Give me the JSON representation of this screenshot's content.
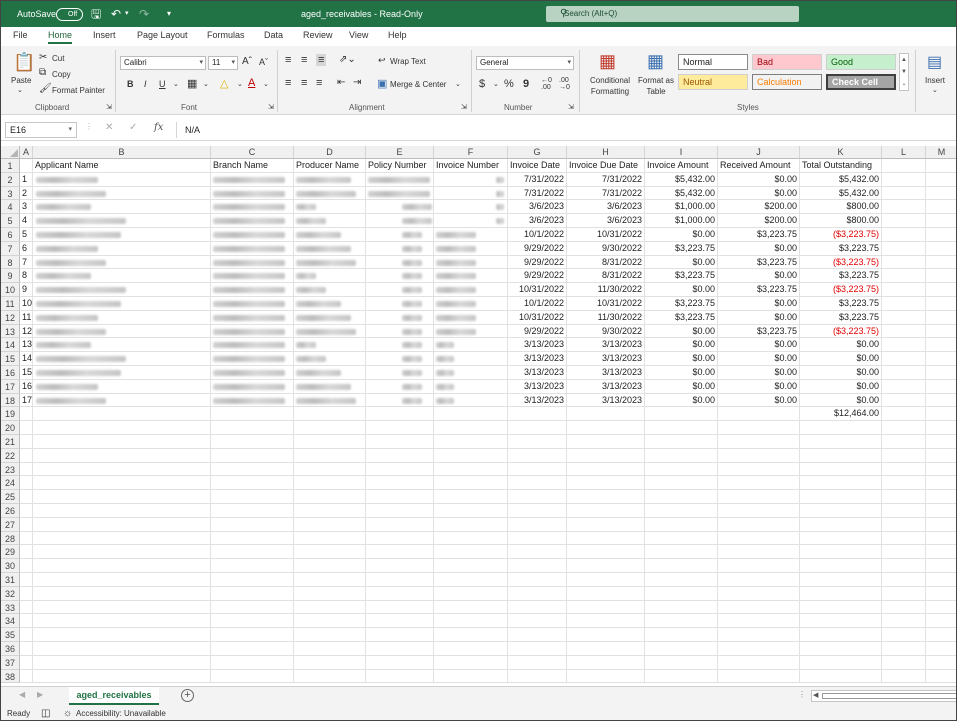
{
  "titlebar": {
    "autosave_label": "AutoSave",
    "autosave_state": "Off",
    "doc_title": "aged_receivables - Read-Only",
    "search_placeholder": "Search (Alt+Q)"
  },
  "menu": {
    "tabs": [
      "File",
      "Home",
      "Insert",
      "Page Layout",
      "Formulas",
      "Data",
      "Review",
      "View",
      "Help"
    ],
    "active": "Home"
  },
  "ribbon": {
    "clipboard": {
      "paste": "Paste",
      "cut": "Cut",
      "copy": "Copy",
      "format_painter": "Format Painter",
      "label": "Clipboard"
    },
    "font": {
      "name": "Calibri",
      "size": "11",
      "label": "Font"
    },
    "alignment": {
      "wrap_text": "Wrap Text",
      "merge_center": "Merge & Center",
      "label": "Alignment"
    },
    "number": {
      "format": "General",
      "label": "Number"
    },
    "styles": {
      "conditional_formatting": "Conditional Formatting",
      "format_as_table": "Format as Table",
      "normal": "Normal",
      "bad": "Bad",
      "good": "Good",
      "neutral": "Neutral",
      "calculation": "Calculation",
      "check_cell": "Check Cell",
      "label": "Styles"
    },
    "cells": {
      "insert": "Insert"
    }
  },
  "formula_bar": {
    "name_box": "E16",
    "fx": "fx",
    "value": "N/A"
  },
  "columns": [
    "A",
    "B",
    "C",
    "D",
    "E",
    "F",
    "G",
    "H",
    "I",
    "J",
    "K",
    "L",
    "M"
  ],
  "headers": {
    "b": "Applicant Name",
    "c": "Branch Name",
    "d": "Producer Name",
    "e": "Policy Number",
    "f": "Invoice Number",
    "g": "Invoice Date",
    "h": "Invoice Due Date",
    "i": "Invoice Amount",
    "j": "Received Amount",
    "k": "Total Outstanding"
  },
  "rows": [
    {
      "a": "1",
      "g": "7/31/2022",
      "h": "7/31/2022",
      "i": "$5,432.00",
      "j": "$0.00",
      "k": "$5,432.00",
      "neg": false
    },
    {
      "a": "2",
      "g": "7/31/2022",
      "h": "7/31/2022",
      "i": "$5,432.00",
      "j": "$0.00",
      "k": "$5,432.00",
      "neg": false
    },
    {
      "a": "3",
      "g": "3/6/2023",
      "h": "3/6/2023",
      "i": "$1,000.00",
      "j": "$200.00",
      "k": "$800.00",
      "neg": false
    },
    {
      "a": "4",
      "g": "3/6/2023",
      "h": "3/6/2023",
      "i": "$1,000.00",
      "j": "$200.00",
      "k": "$800.00",
      "neg": false
    },
    {
      "a": "5",
      "g": "10/1/2022",
      "h": "10/31/2022",
      "i": "$0.00",
      "j": "$3,223.75",
      "k": "($3,223.75)",
      "neg": true
    },
    {
      "a": "6",
      "g": "9/29/2022",
      "h": "9/30/2022",
      "i": "$3,223.75",
      "j": "$0.00",
      "k": "$3,223.75",
      "neg": false
    },
    {
      "a": "7",
      "g": "9/29/2022",
      "h": "8/31/2022",
      "i": "$0.00",
      "j": "$3,223.75",
      "k": "($3,223.75)",
      "neg": true
    },
    {
      "a": "8",
      "g": "9/29/2022",
      "h": "8/31/2022",
      "i": "$3,223.75",
      "j": "$0.00",
      "k": "$3,223.75",
      "neg": false
    },
    {
      "a": "9",
      "g": "10/31/2022",
      "h": "11/30/2022",
      "i": "$0.00",
      "j": "$3,223.75",
      "k": "($3,223.75)",
      "neg": true
    },
    {
      "a": "10",
      "g": "10/1/2022",
      "h": "10/31/2022",
      "i": "$3,223.75",
      "j": "$0.00",
      "k": "$3,223.75",
      "neg": false
    },
    {
      "a": "11",
      "g": "10/31/2022",
      "h": "11/30/2022",
      "i": "$3,223.75",
      "j": "$0.00",
      "k": "$3,223.75",
      "neg": false
    },
    {
      "a": "12",
      "g": "9/29/2022",
      "h": "9/30/2022",
      "i": "$0.00",
      "j": "$3,223.75",
      "k": "($3,223.75)",
      "neg": true
    },
    {
      "a": "13",
      "g": "3/13/2023",
      "h": "3/13/2023",
      "i": "$0.00",
      "j": "$0.00",
      "k": "$0.00",
      "neg": false
    },
    {
      "a": "14",
      "g": "3/13/2023",
      "h": "3/13/2023",
      "i": "$0.00",
      "j": "$0.00",
      "k": "$0.00",
      "neg": false
    },
    {
      "a": "15",
      "g": "3/13/2023",
      "h": "3/13/2023",
      "i": "$0.00",
      "j": "$0.00",
      "k": "$0.00",
      "neg": false
    },
    {
      "a": "16",
      "g": "3/13/2023",
      "h": "3/13/2023",
      "i": "$0.00",
      "j": "$0.00",
      "k": "$0.00",
      "neg": false
    },
    {
      "a": "17",
      "g": "3/13/2023",
      "h": "3/13/2023",
      "i": "$0.00",
      "j": "$0.00",
      "k": "$0.00",
      "neg": false
    }
  ],
  "total_outstanding": "$12,464.00",
  "row_count": 38,
  "sheet_tab": "aged_receivables",
  "status": {
    "ready": "Ready",
    "accessibility": "Accessibility: Unavailable"
  },
  "colors": {
    "accent": "#217346",
    "negative": "#e00000"
  }
}
